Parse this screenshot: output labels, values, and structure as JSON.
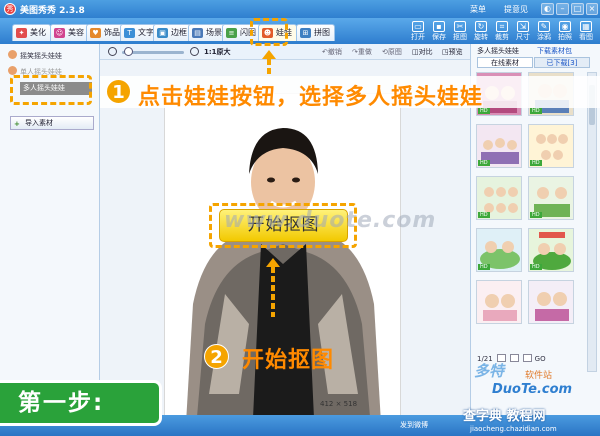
{
  "app": {
    "title": "美图秀秀 2.3.8",
    "logo_char": "秀"
  },
  "titlebar": {
    "menu": "菜单",
    "feedback": "提意见"
  },
  "tabs": [
    {
      "label": "美化",
      "color": "#e24d4d"
    },
    {
      "label": "美容",
      "color": "#d1458f"
    },
    {
      "label": "饰品",
      "color": "#e5892b"
    },
    {
      "label": "文字",
      "color": "#3c8fd6"
    },
    {
      "label": "边框",
      "color": "#3a8cc9"
    },
    {
      "label": "场景",
      "color": "#4a79b8"
    },
    {
      "label": "闪图",
      "color": "#4aa14a"
    },
    {
      "label": "娃娃",
      "color": "#e25b2a"
    },
    {
      "label": "拼图",
      "color": "#3e7fc2"
    }
  ],
  "toolbar": [
    {
      "label": "打开",
      "icon": "open-icon"
    },
    {
      "label": "保存",
      "icon": "save-icon"
    },
    {
      "label": "抠图",
      "icon": "cutout-icon"
    },
    {
      "label": "旋转",
      "icon": "rotate-icon"
    },
    {
      "label": "裁剪",
      "icon": "crop-icon"
    },
    {
      "label": "尺寸",
      "icon": "resize-icon"
    },
    {
      "label": "涂鸦",
      "icon": "brush-icon"
    },
    {
      "label": "拍照",
      "icon": "camera-icon"
    },
    {
      "label": "看图",
      "icon": "view-icon"
    }
  ],
  "left_panel": {
    "items": [
      "摇笑摇头娃娃",
      "单人摇头娃娃",
      "多人摇头娃娃"
    ],
    "import_label": "导入素材"
  },
  "zoombar": {
    "zoom_label": "1:1原大",
    "undo": "撤销",
    "redo": "重做",
    "reset": "原图",
    "compare": "对比",
    "preview": "预览"
  },
  "canvas": {
    "dimensions": "412 × 518",
    "start_button": "开始抠图"
  },
  "right_panel": {
    "title": "多人摇头娃娃",
    "download_link": "下载素材包",
    "tab_online": "在线素材",
    "tab_downloaded": "已下载[3]",
    "thumb_tag": "HD",
    "page": "1/21",
    "go": "GO"
  },
  "statusbar": {
    "share": "发到微博"
  },
  "overlay": {
    "step1_num": "1",
    "step1_text": "点击娃娃按钮，选择多人摇头娃娃",
    "step2_num": "2",
    "step2_text": "开始抠图",
    "step_badge": "第一步:",
    "watermark_center": "www.duote.com"
  },
  "watermarks": {
    "brand": "多特",
    "brand_sub": "软件站",
    "site": "DuoTe.com",
    "bottom": "查字典 教程网",
    "url": "jiaocheng.chazidian.com"
  },
  "colors": {
    "accent_orange": "#f5a400",
    "step_badge_green": "#2aa23a",
    "title_blue": "#3a8ad8"
  }
}
